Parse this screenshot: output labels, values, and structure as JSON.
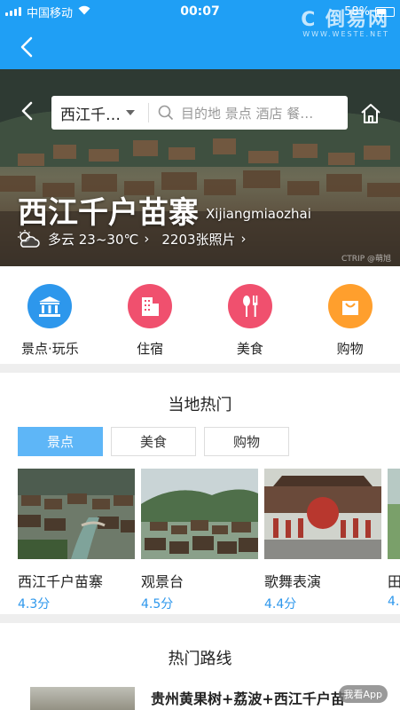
{
  "status_bar": {
    "carrier": "中国移动",
    "time": "00:07",
    "battery": "58%"
  },
  "watermark": {
    "logo": "C 倒易网",
    "url": "WWW.WESTE.NET"
  },
  "hero": {
    "city": "西江千…",
    "search_placeholder": "目的地 景点 酒店 餐…",
    "title": "西江千户苗寨",
    "pinyin": "Xijiangmiaozhai",
    "weather": "多云 23~30℃",
    "photos": "2203张照片",
    "credit": "CTRIP @萌旭"
  },
  "categories": [
    {
      "label": "景点·玩乐",
      "color": "#2d97ec",
      "icon": "museum-icon"
    },
    {
      "label": "住宿",
      "color": "#f0506e",
      "icon": "hotel-icon"
    },
    {
      "label": "美食",
      "color": "#f0506e",
      "icon": "food-icon"
    },
    {
      "label": "购物",
      "color": "#ff9f2d",
      "icon": "shopping-bag-icon"
    }
  ],
  "local_hot": {
    "title": "当地热门",
    "tabs": [
      "景点",
      "美食",
      "购物"
    ],
    "cards": [
      {
        "name": "西江千户苗寨",
        "score": "4.3分"
      },
      {
        "name": "观景台",
        "score": "4.5分"
      },
      {
        "name": "歌舞表演",
        "score": "4.4分"
      },
      {
        "name": "田",
        "score": "4."
      }
    ]
  },
  "routes": {
    "title": "热门路线",
    "first_route": "贵州黄果树+荔波+西江千户苗"
  },
  "app_badge": "我看App",
  "colors": {
    "primary": "#1f9ff5",
    "tab_active": "#5eb6f7",
    "score": "#2d97ec"
  }
}
